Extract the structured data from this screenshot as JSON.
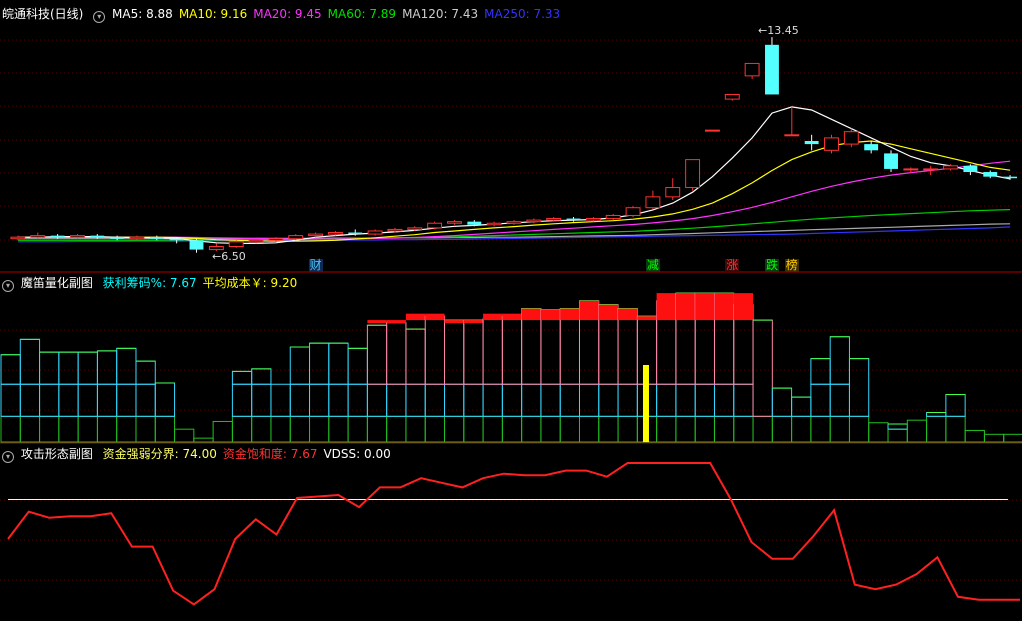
{
  "main_panel": {
    "title": "皖通科技(日线)",
    "ma_items": [
      {
        "label": "MA5: 8.88",
        "color": "#ffffff"
      },
      {
        "label": "MA10: 9.16",
        "color": "#ffff00"
      },
      {
        "label": "MA20: 9.45",
        "color": "#ff33ff"
      },
      {
        "label": "MA60: 7.89",
        "color": "#00e000"
      },
      {
        "label": "MA120: 7.43",
        "color": "#cccccc"
      },
      {
        "label": "MA250: 7.33",
        "color": "#3333ff"
      }
    ],
    "high_label": "13.45",
    "low_label": "6.50",
    "events": [
      {
        "text": "财",
        "index": 15,
        "color": "#4fc3f7",
        "bg": "#0b2a55"
      },
      {
        "text": "减",
        "index": 32,
        "color": "#00ff00",
        "bg": "#0a3a10"
      },
      {
        "text": "涨",
        "index": 36,
        "color": "#ff3333",
        "bg": "#3a0a0a"
      },
      {
        "text": "跌",
        "index": 38,
        "color": "#00ff00",
        "bg": "#0a3a10"
      },
      {
        "text": "榜",
        "index": 39,
        "color": "#ffcc00",
        "bg": "#3a2a00"
      }
    ]
  },
  "sub1": {
    "title": "魔笛量化副图",
    "items": [
      {
        "label": "获利筹码%: 7.67",
        "color": "#00ffff"
      },
      {
        "label": "平均成本￥: 9.20",
        "color": "#ffff00"
      }
    ]
  },
  "sub2": {
    "title": "攻击形态副图",
    "items": [
      {
        "label": "资金强弱分界: 74.00",
        "color": "#ffff66"
      },
      {
        "label": "资金饱和度: 7.67",
        "color": "#ff3333"
      },
      {
        "label": "VDSS: 0.00",
        "color": "#ffffff"
      }
    ]
  },
  "chart_data": [
    {
      "type": "candlestick",
      "title": "皖通科技(日线)",
      "price_range": [
        6.2,
        14.0
      ],
      "candles": [
        {
          "o": 6.95,
          "c": 7.0,
          "h": 7.05,
          "l": 6.9
        },
        {
          "o": 7.0,
          "c": 7.05,
          "h": 7.15,
          "l": 6.95
        },
        {
          "o": 7.05,
          "c": 7.0,
          "h": 7.1,
          "l": 6.95
        },
        {
          "o": 7.0,
          "c": 7.05,
          "h": 7.1,
          "l": 6.95
        },
        {
          "o": 7.05,
          "c": 7.0,
          "h": 7.1,
          "l": 6.95
        },
        {
          "o": 7.0,
          "c": 6.95,
          "h": 7.05,
          "l": 6.9
        },
        {
          "o": 6.95,
          "c": 7.0,
          "h": 7.05,
          "l": 6.9
        },
        {
          "o": 7.0,
          "c": 6.95,
          "h": 7.05,
          "l": 6.9
        },
        {
          "o": 6.95,
          "c": 6.9,
          "h": 7.0,
          "l": 6.8
        },
        {
          "o": 6.9,
          "c": 6.6,
          "h": 6.95,
          "l": 6.5
        },
        {
          "o": 6.6,
          "c": 6.7,
          "h": 6.8,
          "l": 6.55
        },
        {
          "o": 6.7,
          "c": 6.85,
          "h": 6.9,
          "l": 6.65
        },
        {
          "o": 6.85,
          "c": 6.9,
          "h": 6.95,
          "l": 6.8
        },
        {
          "o": 6.9,
          "c": 6.95,
          "h": 7.0,
          "l": 6.85
        },
        {
          "o": 6.95,
          "c": 7.05,
          "h": 7.1,
          "l": 6.9
        },
        {
          "o": 7.05,
          "c": 7.1,
          "h": 7.15,
          "l": 7.0
        },
        {
          "o": 7.1,
          "c": 7.15,
          "h": 7.2,
          "l": 7.05
        },
        {
          "o": 7.15,
          "c": 7.1,
          "h": 7.25,
          "l": 7.05
        },
        {
          "o": 7.1,
          "c": 7.2,
          "h": 7.25,
          "l": 7.05
        },
        {
          "o": 7.2,
          "c": 7.25,
          "h": 7.3,
          "l": 7.15
        },
        {
          "o": 7.25,
          "c": 7.3,
          "h": 7.35,
          "l": 7.2
        },
        {
          "o": 7.3,
          "c": 7.45,
          "h": 7.5,
          "l": 7.25
        },
        {
          "o": 7.45,
          "c": 7.5,
          "h": 7.55,
          "l": 7.4
        },
        {
          "o": 7.5,
          "c": 7.4,
          "h": 7.55,
          "l": 7.35
        },
        {
          "o": 7.4,
          "c": 7.45,
          "h": 7.5,
          "l": 7.35
        },
        {
          "o": 7.45,
          "c": 7.5,
          "h": 7.55,
          "l": 7.4
        },
        {
          "o": 7.5,
          "c": 7.55,
          "h": 7.6,
          "l": 7.45
        },
        {
          "o": 7.55,
          "c": 7.6,
          "h": 7.65,
          "l": 7.5
        },
        {
          "o": 7.6,
          "c": 7.55,
          "h": 7.65,
          "l": 7.5
        },
        {
          "o": 7.55,
          "c": 7.6,
          "h": 7.65,
          "l": 7.5
        },
        {
          "o": 7.6,
          "c": 7.7,
          "h": 7.75,
          "l": 7.55
        },
        {
          "o": 7.7,
          "c": 7.95,
          "h": 8.0,
          "l": 7.65
        },
        {
          "o": 7.95,
          "c": 8.3,
          "h": 8.5,
          "l": 7.9
        },
        {
          "o": 8.3,
          "c": 8.6,
          "h": 8.9,
          "l": 8.2
        },
        {
          "o": 8.6,
          "c": 9.5,
          "h": 9.5,
          "l": 8.5
        },
        {
          "o": 10.45,
          "c": 10.45,
          "h": 10.45,
          "l": 10.45
        },
        {
          "o": 11.45,
          "c": 11.6,
          "h": 11.6,
          "l": 11.4
        },
        {
          "o": 12.2,
          "c": 12.6,
          "h": 12.6,
          "l": 12.1
        },
        {
          "o": 13.2,
          "c": 11.6,
          "h": 13.45,
          "l": 11.6
        },
        {
          "o": 10.3,
          "c": 10.3,
          "h": 11.2,
          "l": 10.3
        },
        {
          "o": 10.1,
          "c": 10.0,
          "h": 10.3,
          "l": 9.8
        },
        {
          "o": 9.8,
          "c": 10.2,
          "h": 10.3,
          "l": 9.7
        },
        {
          "o": 10.0,
          "c": 10.4,
          "h": 10.5,
          "l": 9.9
        },
        {
          "o": 10.0,
          "c": 9.8,
          "h": 10.1,
          "l": 9.7
        },
        {
          "o": 9.7,
          "c": 9.2,
          "h": 9.8,
          "l": 9.1
        },
        {
          "o": 9.2,
          "c": 9.2,
          "h": 9.25,
          "l": 9.05
        },
        {
          "o": 9.2,
          "c": 9.2,
          "h": 9.3,
          "l": 9.0
        },
        {
          "o": 9.2,
          "c": 9.3,
          "h": 9.35,
          "l": 9.15
        },
        {
          "o": 9.3,
          "c": 9.1,
          "h": 9.35,
          "l": 9.0
        },
        {
          "o": 9.1,
          "c": 8.95,
          "h": 9.15,
          "l": 8.9
        },
        {
          "o": 8.95,
          "c": 8.9,
          "h": 9.0,
          "l": 8.85
        }
      ],
      "ma5": [
        7.0,
        7.0,
        7.02,
        7.02,
        7.02,
        7.0,
        6.99,
        6.98,
        6.96,
        6.88,
        6.82,
        6.8,
        6.8,
        6.82,
        6.9,
        7.0,
        7.05,
        7.1,
        7.13,
        7.17,
        7.22,
        7.29,
        7.35,
        7.38,
        7.42,
        7.46,
        7.5,
        7.53,
        7.55,
        7.57,
        7.62,
        7.72,
        7.88,
        8.1,
        8.45,
        8.95,
        9.55,
        10.2,
        11.0,
        11.2,
        11.1,
        10.8,
        10.5,
        10.2,
        9.9,
        9.6,
        9.4,
        9.3,
        9.15,
        9.0,
        8.88
      ],
      "ma10": [
        7.0,
        7.0,
        7.0,
        7.0,
        7.0,
        7.0,
        7.0,
        7.0,
        6.99,
        6.96,
        6.92,
        6.9,
        6.88,
        6.87,
        6.87,
        6.88,
        6.9,
        6.94,
        6.98,
        7.03,
        7.08,
        7.15,
        7.2,
        7.25,
        7.3,
        7.34,
        7.39,
        7.43,
        7.47,
        7.5,
        7.53,
        7.58,
        7.65,
        7.75,
        7.9,
        8.1,
        8.4,
        8.75,
        9.15,
        9.5,
        9.75,
        9.95,
        10.05,
        10.1,
        10.0,
        9.85,
        9.7,
        9.55,
        9.4,
        9.25,
        9.16
      ],
      "ma20": [
        7.0,
        7.0,
        7.0,
        7.0,
        7.0,
        7.0,
        7.0,
        7.0,
        7.0,
        6.99,
        6.98,
        6.97,
        6.96,
        6.95,
        6.94,
        6.94,
        6.94,
        6.95,
        6.96,
        6.97,
        6.99,
        7.02,
        7.05,
        7.09,
        7.13,
        7.17,
        7.21,
        7.25,
        7.29,
        7.33,
        7.37,
        7.41,
        7.46,
        7.52,
        7.6,
        7.7,
        7.82,
        7.96,
        8.12,
        8.3,
        8.48,
        8.64,
        8.78,
        8.9,
        9.0,
        9.08,
        9.15,
        9.22,
        9.3,
        9.38,
        9.45
      ],
      "ma60": [
        6.9,
        6.9,
        6.9,
        6.9,
        6.9,
        6.9,
        6.9,
        6.9,
        6.91,
        6.91,
        6.91,
        6.92,
        6.92,
        6.93,
        6.93,
        6.94,
        6.95,
        6.96,
        6.97,
        6.98,
        6.99,
        7.0,
        7.01,
        7.03,
        7.05,
        7.07,
        7.09,
        7.11,
        7.13,
        7.15,
        7.17,
        7.19,
        7.22,
        7.25,
        7.29,
        7.33,
        7.38,
        7.43,
        7.48,
        7.53,
        7.58,
        7.62,
        7.66,
        7.7,
        7.73,
        7.76,
        7.79,
        7.82,
        7.85,
        7.87,
        7.89
      ],
      "ma120": [
        6.95,
        6.95,
        6.95,
        6.95,
        6.95,
        6.95,
        6.95,
        6.95,
        6.95,
        6.95,
        6.95,
        6.95,
        6.96,
        6.96,
        6.96,
        6.96,
        6.97,
        6.97,
        6.97,
        6.98,
        6.98,
        6.98,
        6.99,
        6.99,
        7.0,
        7.0,
        7.01,
        7.02,
        7.03,
        7.04,
        7.05,
        7.06,
        7.08,
        7.1,
        7.12,
        7.14,
        7.16,
        7.18,
        7.2,
        7.22,
        7.24,
        7.26,
        7.28,
        7.3,
        7.32,
        7.34,
        7.36,
        7.38,
        7.4,
        7.42,
        7.43
      ],
      "ma250": [
        6.85,
        6.85,
        6.85,
        6.86,
        6.86,
        6.86,
        6.87,
        6.87,
        6.87,
        6.88,
        6.88,
        6.88,
        6.89,
        6.89,
        6.9,
        6.9,
        6.9,
        6.91,
        6.91,
        6.92,
        6.92,
        6.93,
        6.93,
        6.94,
        6.95,
        6.96,
        6.97,
        6.98,
        6.99,
        7.0,
        7.01,
        7.02,
        7.03,
        7.04,
        7.05,
        7.06,
        7.07,
        7.08,
        7.09,
        7.1,
        7.12,
        7.14,
        7.16,
        7.18,
        7.2,
        7.22,
        7.24,
        7.26,
        7.28,
        7.3,
        7.33
      ]
    },
    {
      "type": "bar",
      "title": "魔笛量化副图",
      "ylim": [
        0,
        100
      ],
      "top": [
        68,
        80,
        70,
        70,
        70,
        71,
        73,
        63,
        46,
        10,
        3,
        16,
        55,
        57,
        45,
        74,
        77,
        77,
        73,
        91,
        93,
        88,
        98,
        95,
        95,
        96,
        98,
        104,
        103,
        104,
        110,
        107,
        104,
        98,
        110,
        116,
        116,
        116,
        107,
        95,
        42,
        35,
        65,
        82,
        65,
        15,
        14,
        17,
        23,
        37,
        9,
        6,
        6
      ],
      "mid": [
        45,
        45,
        45,
        45,
        45,
        45,
        45,
        45,
        20,
        0,
        0,
        0,
        45,
        45,
        45,
        45,
        45,
        45,
        45,
        45,
        45,
        45,
        45,
        45,
        45,
        45,
        45,
        45,
        45,
        45,
        45,
        45,
        45,
        45,
        45,
        45,
        45,
        45,
        45,
        20,
        20,
        20,
        45,
        45,
        20,
        0,
        0,
        0,
        20,
        20,
        0,
        0,
        0
      ],
      "base": [
        20,
        20,
        20,
        20,
        20,
        20,
        20,
        20,
        20,
        10,
        3,
        16,
        20,
        20,
        20,
        20,
        20,
        20,
        20,
        20,
        20,
        20,
        20,
        20,
        20,
        20,
        20,
        20,
        20,
        20,
        20,
        20,
        20,
        20,
        20,
        20,
        20,
        20,
        20,
        20,
        20,
        20,
        20,
        20,
        20,
        15,
        10,
        17,
        20,
        20,
        9,
        6,
        6
      ],
      "red": [
        0,
        0,
        0,
        0,
        0,
        0,
        0,
        0,
        0,
        0,
        0,
        0,
        0,
        0,
        0,
        0,
        0,
        0,
        0,
        95,
        95,
        100,
        100,
        95,
        95,
        100,
        100,
        104,
        103,
        104,
        110,
        107,
        104,
        98,
        116,
        116,
        116,
        116,
        116,
        0,
        0,
        0,
        0,
        0,
        0,
        0,
        0,
        0,
        0,
        0,
        0,
        0,
        0
      ],
      "yellow_index": 33,
      "yellow_value": 60
    },
    {
      "type": "line",
      "title": "攻击形态副图",
      "ylim": [
        0,
        100
      ],
      "threshold": 74.0,
      "values": [
        48,
        66,
        62,
        63,
        63,
        65,
        43,
        43,
        14,
        5,
        15,
        48,
        61,
        51,
        75,
        76,
        77,
        69,
        82,
        82,
        88,
        85,
        82,
        88,
        91,
        90,
        90,
        93,
        93,
        89,
        98,
        98,
        98,
        98,
        98,
        74,
        46,
        35,
        35,
        50,
        67,
        18,
        15,
        18,
        25,
        36,
        10,
        8,
        8,
        8
      ]
    }
  ]
}
